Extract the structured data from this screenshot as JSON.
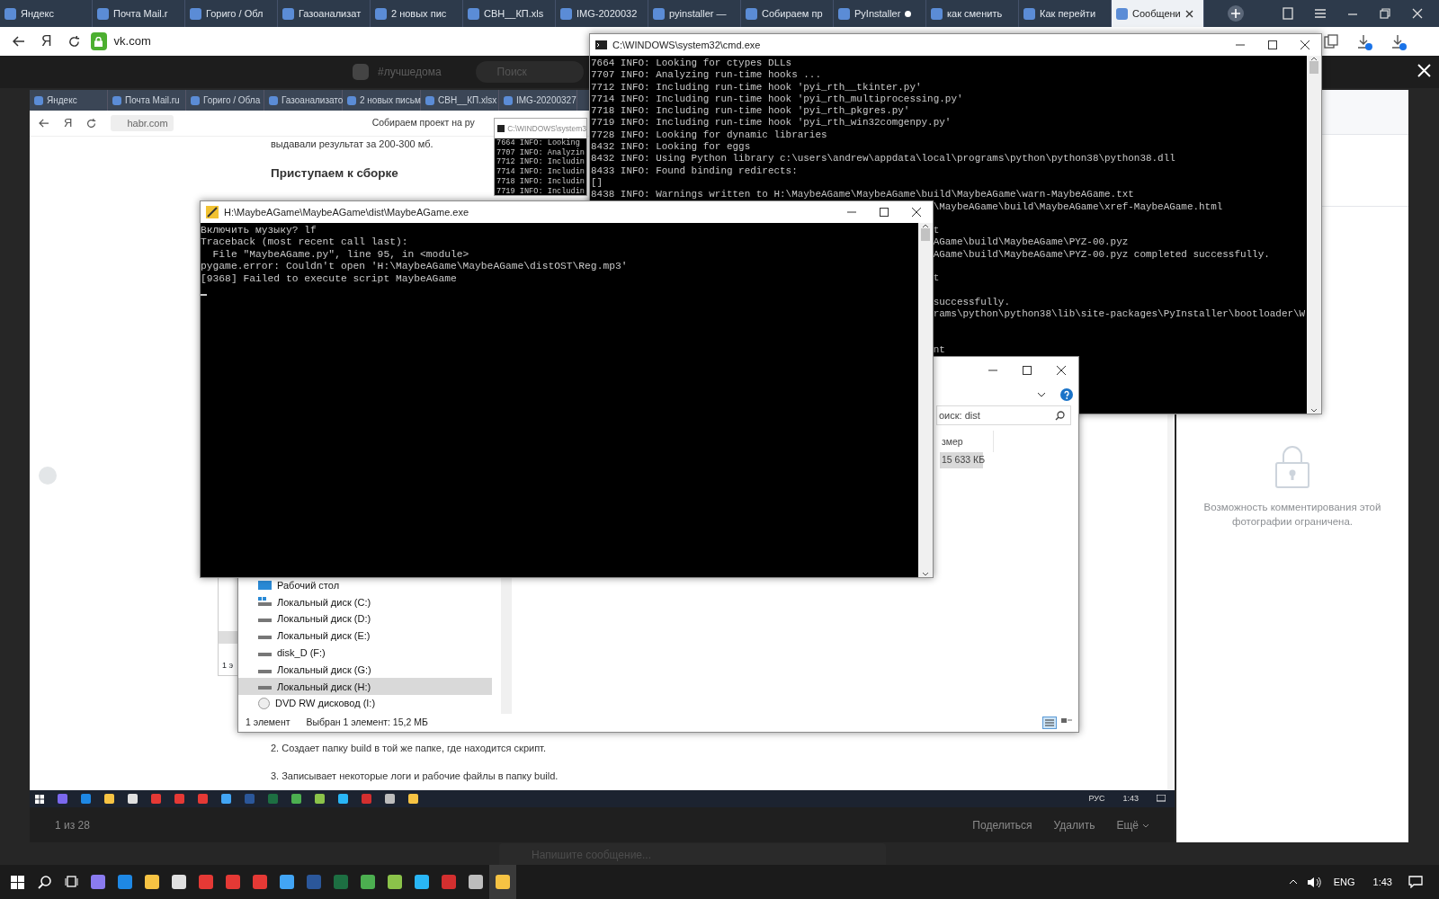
{
  "browser": {
    "tabs": [
      {
        "label": "Яндекс",
        "selected": false,
        "dot": false
      },
      {
        "label": "Почта Mail.r",
        "selected": false,
        "dot": false
      },
      {
        "label": "Гориго / Обл",
        "selected": false,
        "dot": false
      },
      {
        "label": "Газоанализат",
        "selected": false,
        "dot": false
      },
      {
        "label": "2 новых пис",
        "selected": false,
        "dot": false
      },
      {
        "label": "СВН__КП.xls",
        "selected": false,
        "dot": false
      },
      {
        "label": "IMG-2020032",
        "selected": false,
        "dot": false
      },
      {
        "label": "pyinstaller —",
        "selected": false,
        "dot": false
      },
      {
        "label": "Собираем пр",
        "selected": false,
        "dot": false
      },
      {
        "label": "PyInstaller",
        "selected": false,
        "dot": true
      },
      {
        "label": "как сменить",
        "selected": false,
        "dot": false
      },
      {
        "label": "Как перейти",
        "selected": false,
        "dot": false
      },
      {
        "label": "Сообщени",
        "selected": true,
        "dot": false
      }
    ],
    "logo": "Я",
    "address": "vk.com"
  },
  "vk_header": {
    "hashtag": "#лучшедома",
    "search_placeholder": "Поиск"
  },
  "photo": {
    "inner_browser": {
      "tabs": [
        "Яндекс",
        "Почта Mail.ru",
        "Гориго / Обла",
        "Газоанализато",
        "2 новых письм",
        "СВН__КП.xlsx",
        "IMG-20200327"
      ],
      "logo": "Я",
      "address": "habr.com",
      "page_title": "Собираем проект на ру",
      "intro": "выдавали результат за 200-300 мб.",
      "heading": "Приступаем к сборке",
      "steps": [
        "2. Создает папку build в той же папке, где находится скрипт.",
        "3. Записывает некоторые логи и рабочие файлы в папку build."
      ]
    },
    "inner_cmd": {
      "title": "C:\\WINDOWS\\system3",
      "lines": [
        "7664 INFO: Looking",
        "7707 INFO: Analyzin",
        "7712 INFO: Includin",
        "7714 INFO: Includin",
        "7718 INFO: Includin",
        "7719 INFO: Includin"
      ]
    },
    "inner_taskbar": {
      "language": "РУС",
      "time": "1:43"
    },
    "counter": "1 из 28",
    "actions": [
      "Поделиться",
      "Удалить",
      "Ещё"
    ]
  },
  "side_panel": {
    "notice": "Возможность комментирования этой фотографии ограничена."
  },
  "message_placeholder": "Напишите сообщение...",
  "back_window": {
    "status": "1 э"
  },
  "cmd_window": {
    "title": "C:\\WINDOWS\\system32\\cmd.exe",
    "lines": [
      {
        "kind": "full",
        "text": "7664 INFO: Looking for ctypes DLLs"
      },
      {
        "kind": "full",
        "text": "7707 INFO: Analyzing run-time hooks ..."
      },
      {
        "kind": "full",
        "text": "7712 INFO: Including run-time hook 'pyi_rth__tkinter.py'"
      },
      {
        "kind": "full",
        "text": "7714 INFO: Including run-time hook 'pyi_rth_multiprocessing.py'"
      },
      {
        "kind": "full",
        "text": "7718 INFO: Including run-time hook 'pyi_rth_pkgres.py'"
      },
      {
        "kind": "full",
        "text": "7719 INFO: Including run-time hook 'pyi_rth_win32comgenpy.py'"
      },
      {
        "kind": "full",
        "text": "7728 INFO: Looking for dynamic libraries"
      },
      {
        "kind": "full",
        "text": "8432 INFO: Looking for eggs"
      },
      {
        "kind": "full",
        "text": "8432 INFO: Using Python library c:\\users\\andrew\\appdata\\local\\programs\\python\\python38\\python38.dll"
      },
      {
        "kind": "full",
        "text": "8433 INFO: Found binding redirects:"
      },
      {
        "kind": "full",
        "text": "[]"
      },
      {
        "kind": "full",
        "text": "8438 INFO: Warnings written to H:\\MaybeAGame\\MaybeAGame\\build\\MaybeAGame\\warn-MaybeAGame.txt"
      },
      {
        "kind": "tail",
        "text": "\\MaybeAGame\\build\\MaybeAGame\\xref-MaybeAGame.html"
      },
      {
        "kind": "covered"
      },
      {
        "kind": "tail",
        "text": "t"
      },
      {
        "kind": "tail",
        "text": "AGame\\build\\MaybeAGame\\PYZ-00.pyz"
      },
      {
        "kind": "tail",
        "text": "AGame\\build\\MaybeAGame\\PYZ-00.pyz completed successfully."
      },
      {
        "kind": "covered"
      },
      {
        "kind": "tail",
        "text": "t"
      },
      {
        "kind": "covered"
      },
      {
        "kind": "tail",
        "text": "successfully."
      },
      {
        "kind": "tail",
        "text": "rams\\python\\python38\\lib\\site-packages\\PyInstaller\\bootloader\\W"
      },
      {
        "kind": "covered"
      },
      {
        "kind": "covered"
      },
      {
        "kind": "tail",
        "text": "nt"
      }
    ]
  },
  "explorer": {
    "search": "оиск: dist",
    "column": "змер",
    "file_size": "15 633 КБ",
    "nav": [
      {
        "label": "Рабочий стол",
        "kind": "desktop",
        "selected": false
      },
      {
        "label": "Локальный диск (C:)",
        "kind": "system",
        "selected": false
      },
      {
        "label": "Локальный диск (D:)",
        "kind": "drive",
        "selected": false
      },
      {
        "label": "Локальный диск (E:)",
        "kind": "drive",
        "selected": false
      },
      {
        "label": "disk_D (F:)",
        "kind": "drive",
        "selected": false
      },
      {
        "label": "Локальный диск (G:)",
        "kind": "drive",
        "selected": false
      },
      {
        "label": "Локальный диск (H:)",
        "kind": "drive",
        "selected": true
      },
      {
        "label": "DVD RW дисковод (I:)",
        "kind": "disc",
        "selected": false
      }
    ],
    "status": [
      "1 элемент",
      "Выбран 1 элемент: 15,2 МБ"
    ]
  },
  "game_window": {
    "title": "H:\\MaybeAGame\\MaybeAGame\\dist\\MaybeAGame.exe",
    "lines": [
      "Включить музыку? lf",
      "Traceback (most recent call last):",
      "  File \"MaybeAGame.py\", line 95, in <module>",
      "pygame.error: Couldn't open 'H:\\MaybeAGame\\MaybeAGame\\distOST\\Reg.mp3'",
      "[9368] Failed to execute script MaybeAGame"
    ]
  },
  "taskbar": {
    "language": "ENG",
    "time": "1:43"
  }
}
